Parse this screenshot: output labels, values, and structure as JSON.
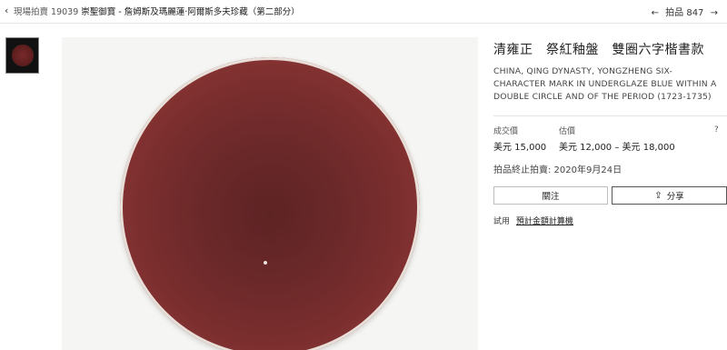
{
  "topbar": {
    "back_icon": "chevron-left-icon",
    "sale_prefix": "現場拍賣 19039",
    "sale_title": "崇聖御寶 - 詹姆斯及瑪麗蓮·阿爾斯多夫珍藏（第二部分）",
    "lot_label": "拍品 847",
    "prev_icon": "arrow-left-icon",
    "next_icon": "arrow-right-icon"
  },
  "lot": {
    "title_zh": "清雍正　祭紅釉盤　雙圈六字楷書款",
    "title_en": "CHINA, QING DYNASTY, YONGZHENG SIX-CHARACTER MARK IN UNDERGLAZE BLUE WITHIN A DOUBLE CIRCLE AND OF THE PERIOD (1723-1735)"
  },
  "pricing": {
    "sold_label": "成交價",
    "sold_value": "美元 15,000",
    "estimate_label": "估價",
    "estimate_value": "美元 12,000 – 美元 18,000",
    "help": "?"
  },
  "auction_end": "拍品終止拍賣: 2020年9月24日",
  "actions": {
    "follow_label": "關注",
    "share_label": "分享",
    "share_icon": "share-icon"
  },
  "calculator": {
    "prefix": "試用",
    "link": "預計金額計算機"
  },
  "colors": {
    "glaze": "#7b2e2e",
    "background": "#f5f5f3"
  }
}
